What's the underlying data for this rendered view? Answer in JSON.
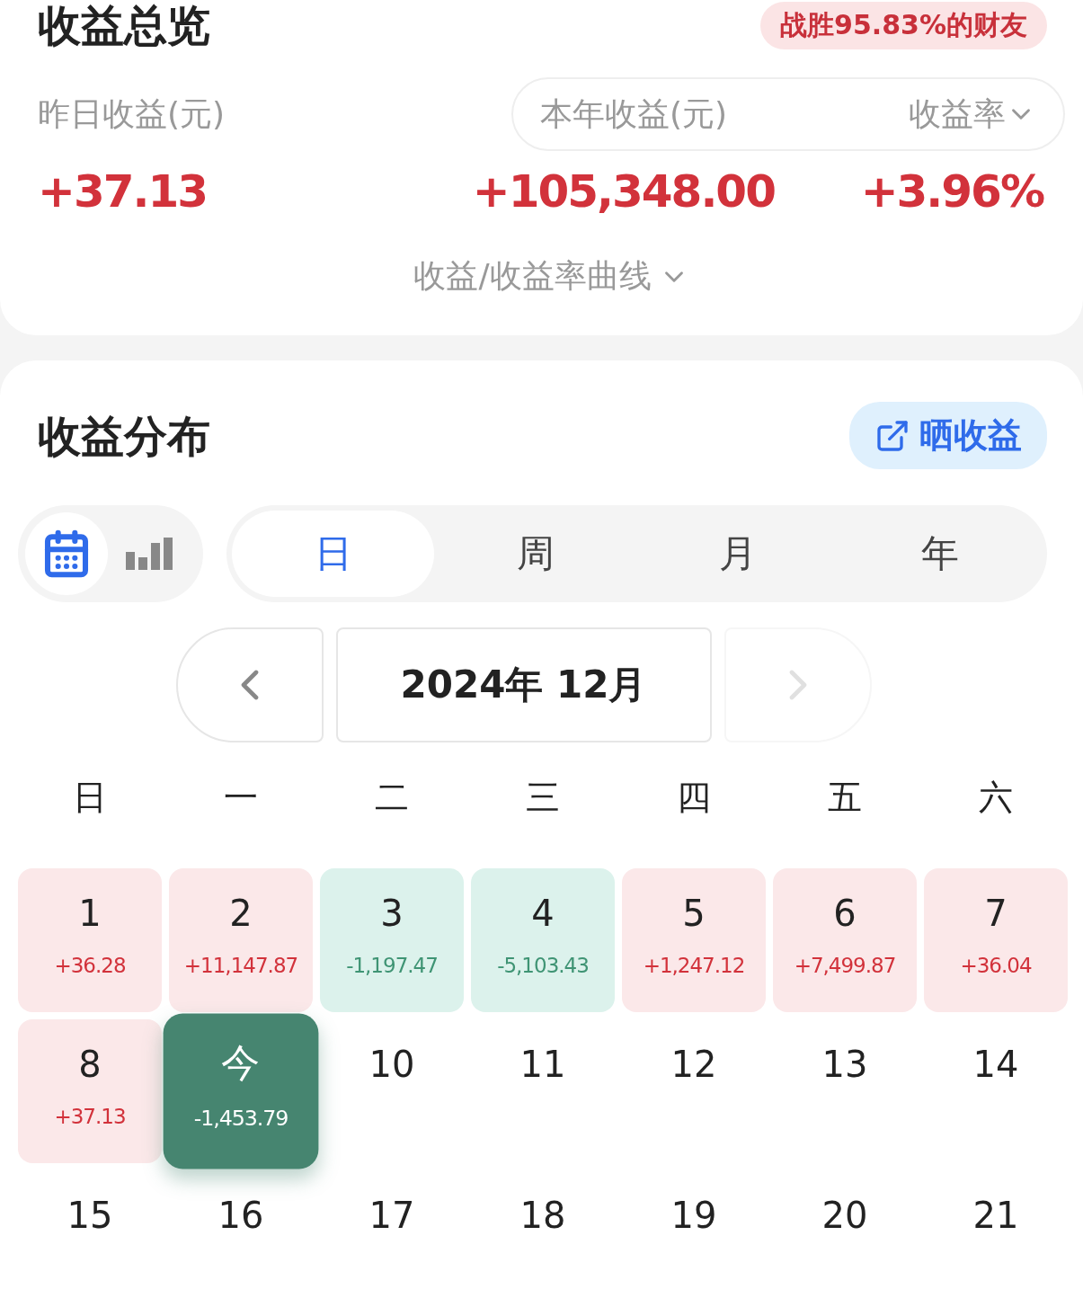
{
  "overview": {
    "title": "收益总览",
    "badge": "战胜95.83%的财友",
    "yesterday": {
      "label": "昨日收益(元)",
      "value": "+37.13"
    },
    "year": {
      "label": "本年收益(元)",
      "value": "+105,348.00"
    },
    "rate": {
      "label": "收益率",
      "value": "+3.96%"
    },
    "curve_toggle": "收益/收益率曲线"
  },
  "distribution": {
    "title": "收益分布",
    "share_button": "晒收益",
    "view_toggle": [
      {
        "kind": "calendar",
        "selected": true
      },
      {
        "kind": "bars",
        "selected": false
      }
    ],
    "periods": [
      {
        "label": "日",
        "selected": true
      },
      {
        "label": "周",
        "selected": false
      },
      {
        "label": "月",
        "selected": false
      },
      {
        "label": "年",
        "selected": false
      }
    ],
    "month_nav": {
      "prev_disabled": false,
      "label": "2024年 12月",
      "next_disabled": true
    },
    "weekdays": [
      "日",
      "一",
      "二",
      "三",
      "四",
      "五",
      "六"
    ],
    "days": [
      {
        "day": "1",
        "value": "+36.28",
        "kind": "gain"
      },
      {
        "day": "2",
        "value": "+11,147.87",
        "kind": "gain"
      },
      {
        "day": "3",
        "value": "-1,197.47",
        "kind": "loss"
      },
      {
        "day": "4",
        "value": "-5,103.43",
        "kind": "loss"
      },
      {
        "day": "5",
        "value": "+1,247.12",
        "kind": "gain"
      },
      {
        "day": "6",
        "value": "+7,499.87",
        "kind": "gain"
      },
      {
        "day": "7",
        "value": "+36.04",
        "kind": "gain"
      },
      {
        "day": "8",
        "value": "+37.13",
        "kind": "gain"
      },
      {
        "day": "今",
        "value": "-1,453.79",
        "kind": "today"
      },
      {
        "day": "10",
        "kind": "future"
      },
      {
        "day": "11",
        "kind": "future"
      },
      {
        "day": "12",
        "kind": "future"
      },
      {
        "day": "13",
        "kind": "future"
      },
      {
        "day": "14",
        "kind": "future"
      },
      {
        "day": "15",
        "kind": "future"
      },
      {
        "day": "16",
        "kind": "future"
      },
      {
        "day": "17",
        "kind": "future"
      },
      {
        "day": "18",
        "kind": "future"
      },
      {
        "day": "19",
        "kind": "future"
      },
      {
        "day": "20",
        "kind": "future"
      },
      {
        "day": "21",
        "kind": "future"
      }
    ]
  }
}
